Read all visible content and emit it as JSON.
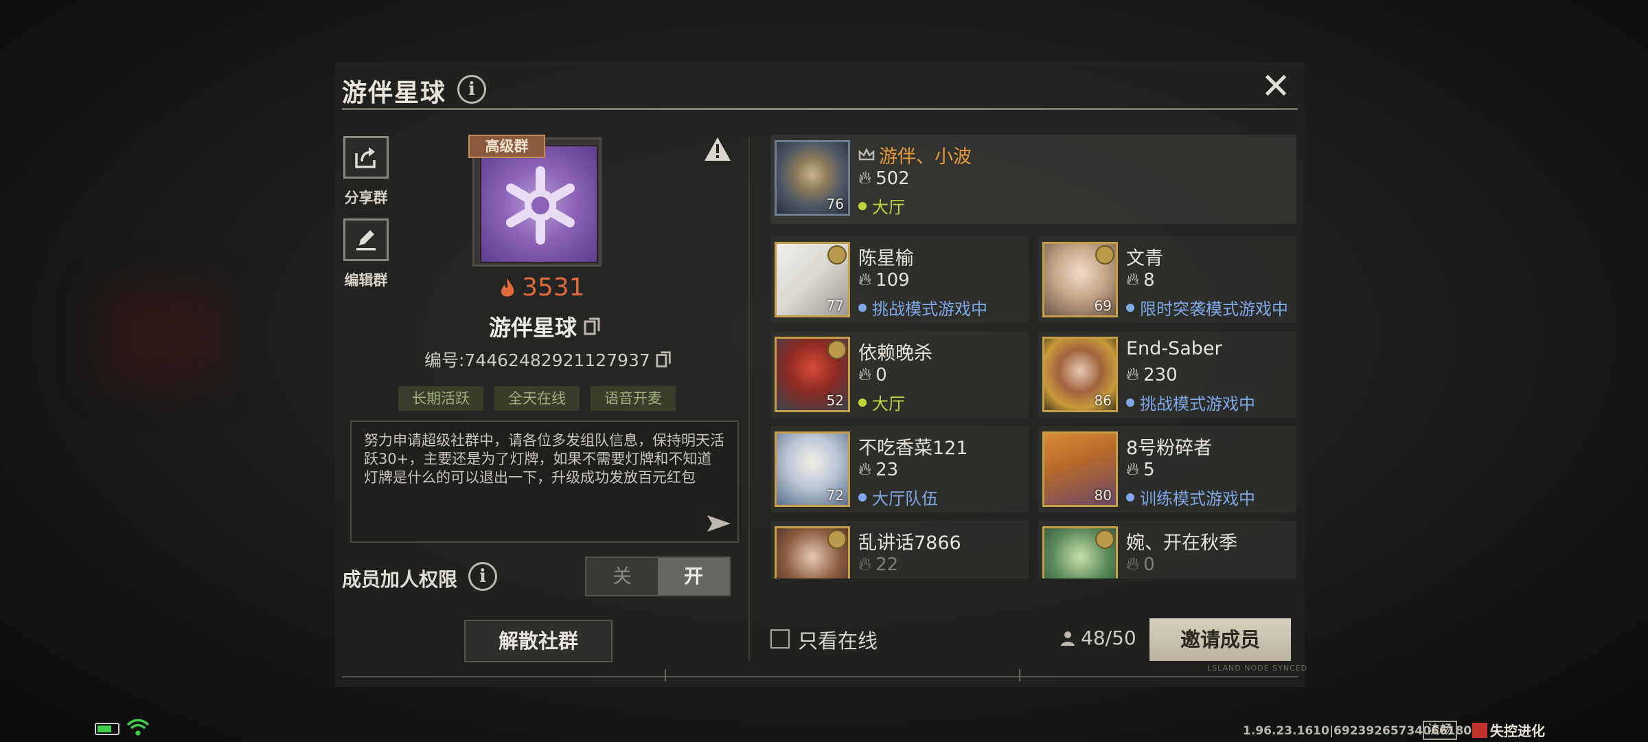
{
  "header": {
    "title": "游伴星球",
    "info_icon": "info-icon",
    "close_icon": "close-icon"
  },
  "side_actions": [
    {
      "label": "分享群",
      "icon": "share-icon"
    },
    {
      "label": "编辑群",
      "icon": "edit-icon"
    }
  ],
  "group": {
    "tier_tag": "高级群",
    "heat": "3531",
    "name": "游伴星球",
    "id_text": "编号:74462482921127937",
    "tags": [
      "长期活跃",
      "全天在线",
      "语音开麦"
    ],
    "notice": "努力申请超级社群中，请各位多发组队信息，保持明天活跃30+，主要还是为了灯牌，如果不需要灯牌和不知道灯牌是什么的可以退出一下，升级成功发放百元红包"
  },
  "permission": {
    "label": "成员加人权限",
    "off_label": "关",
    "on_label": "开",
    "selected": "开"
  },
  "disband_label": "解散社群",
  "owner": {
    "name": "游伴、小波",
    "heat": "502",
    "status": "大厅",
    "level": "76"
  },
  "members": [
    {
      "name": "陈星榆",
      "heat": "109",
      "status": "挑战模式游戏中",
      "level": "77"
    },
    {
      "name": "文青",
      "heat": "8",
      "status": "限时突袭模式游戏中",
      "level": "69"
    },
    {
      "name": "依赖晚杀",
      "heat": "0",
      "status": "大厅",
      "level": "52"
    },
    {
      "name": "End-Saber",
      "heat": "230",
      "status": "挑战模式游戏中",
      "level": "86"
    },
    {
      "name": "不吃香菜121",
      "heat": "23",
      "status": "大厅队伍",
      "level": "72"
    },
    {
      "name": "8号粉碎者",
      "heat": "5",
      "status": "训练模式游戏中",
      "level": "80"
    },
    {
      "name": "乱讲话7866",
      "heat": "22",
      "status": "",
      "level": ""
    },
    {
      "name": "婉、开在秋季",
      "heat": "0",
      "status": "",
      "level": ""
    }
  ],
  "footer": {
    "online_only_label": "只看在线",
    "member_count": "48/50",
    "invite_label": "邀请成员",
    "sync_text": "LSLAND NODE SYNCED"
  },
  "status_bar": {
    "version": "1.96.23.1610|69239265734066180",
    "network": "流畅",
    "logo_text": "失控进化"
  },
  "colors": {
    "heat": "#e06a3c",
    "owner_name": "#e89a3c",
    "lobby_status": "#c3d63e",
    "game_status": "#7fa8e8",
    "tag_text": "#9fb07a"
  }
}
